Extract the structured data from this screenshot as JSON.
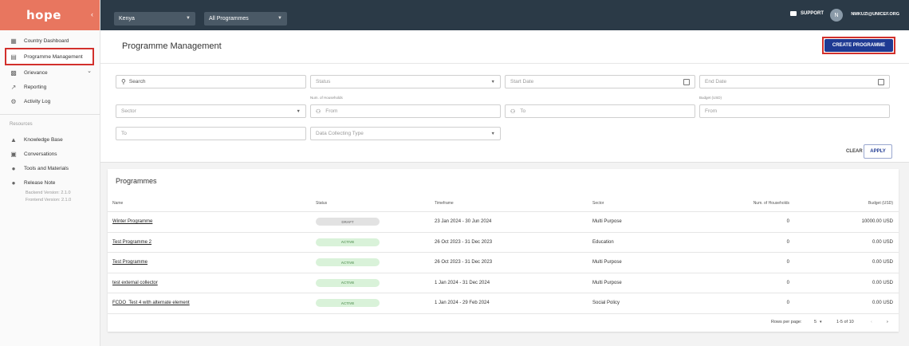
{
  "sidebar": {
    "logo": "hope",
    "items": [
      {
        "label": "Country Dashboard",
        "icon": "dashboard-icon"
      },
      {
        "label": "Programme Management",
        "icon": "document-icon"
      },
      {
        "label": "Grievance",
        "icon": "grievance-icon"
      },
      {
        "label": "Reporting",
        "icon": "trending-icon"
      },
      {
        "label": "Activity Log",
        "icon": "gear-icon"
      }
    ],
    "resources_label": "Resources",
    "resources": [
      {
        "label": "Knowledge Base",
        "icon": "knowledge-icon"
      },
      {
        "label": "Conversations",
        "icon": "chat-icon"
      },
      {
        "label": "Tools and Materials",
        "icon": "info-icon"
      },
      {
        "label": "Release Note",
        "icon": "info-icon"
      }
    ],
    "backend_version": "Backend Version: 2.1.0",
    "frontend_version": "Frontend Version: 2.1.0"
  },
  "topbar": {
    "country": "Kenya",
    "programme_filter": "All Programmes",
    "support": "SUPPORT",
    "avatar_initial": "N",
    "user_email": "NMKUZI@UNICEF.ORG"
  },
  "header": {
    "title": "Programme Management",
    "create_button": "CREATE PROGRAMME"
  },
  "filters": {
    "search": "Search",
    "status": "Status",
    "start_date": "Start Date",
    "end_date": "End Date",
    "sector": "Sector",
    "households_label": "Num. of Households",
    "households_from": "From",
    "households_to": "To",
    "budget_label": "Budget (USD)",
    "budget_from": "From",
    "budget_to": "To",
    "data_collecting_type": "Data Collecting Type",
    "clear": "CLEAR",
    "apply": "APPLY"
  },
  "table": {
    "title": "Programmes",
    "headers": [
      "Name",
      "Status",
      "Timeframe",
      "Sector",
      "Num. of Households",
      "Budget (USD)"
    ],
    "rows": [
      {
        "name": "Winter Programme",
        "status": "DRAFT",
        "timeframe": "23 Jan 2024 - 30 Jun 2024",
        "sector": "Multi Purpose",
        "households": "0",
        "budget": "10000.00 USD"
      },
      {
        "name": "Test Programme 2",
        "status": "ACTIVE",
        "timeframe": "26 Oct 2023 - 31 Dec 2023",
        "sector": "Education",
        "households": "0",
        "budget": "0.00 USD"
      },
      {
        "name": "Test Programme",
        "status": "ACTIVE",
        "timeframe": "26 Oct 2023 - 31 Dec 2023",
        "sector": "Multi Purpose",
        "households": "0",
        "budget": "0.00 USD"
      },
      {
        "name": "test external collector",
        "status": "ACTIVE",
        "timeframe": "1 Jan 2024 - 31 Dec 2024",
        "sector": "Multi Purpose",
        "households": "0",
        "budget": "0.00 USD"
      },
      {
        "name": "FCDO_Test 4 with alternate element",
        "status": "ACTIVE",
        "timeframe": "1 Jan 2024 - 29 Feb 2024",
        "sector": "Social Policy",
        "households": "0",
        "budget": "0.00 USD"
      }
    ],
    "rows_per_page_label": "Rows per page:",
    "rows_per_page": "5",
    "range": "1-5 of 10"
  },
  "colors": {
    "logo_bg": "#e8765f",
    "topbar_bg": "#2b3a47",
    "primary": "#1f3a93",
    "highlight": "#d2302c",
    "active_badge": "#d9f2d9"
  }
}
